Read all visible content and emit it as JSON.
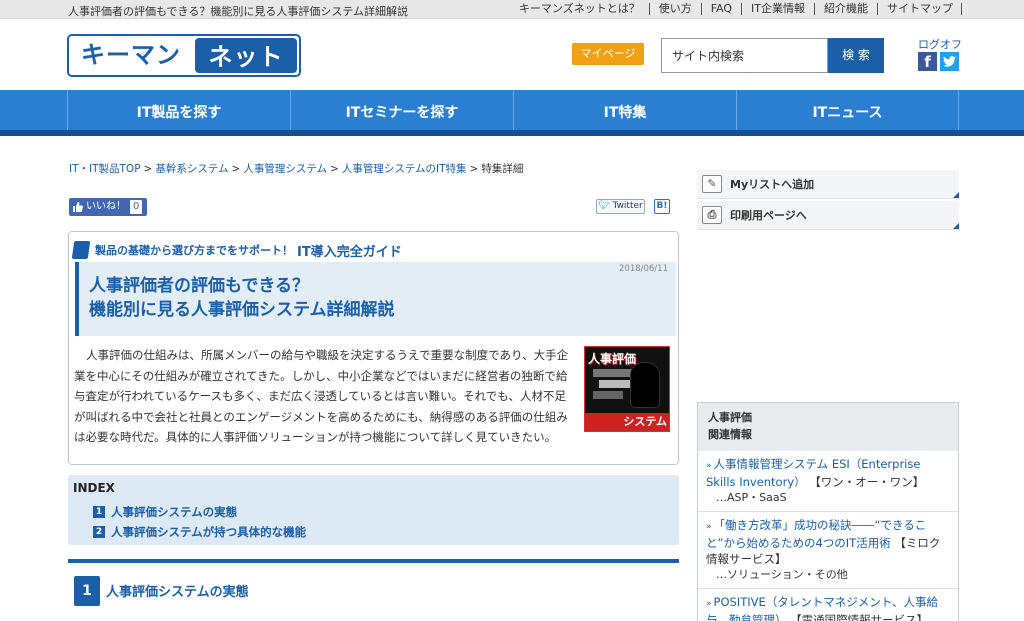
{
  "topbar": {
    "tagline": "人事評価者の評価もできる？機能別に見る人事評価システム詳細解説",
    "links": [
      "キーマンズネットとは？",
      "使い方",
      "FAQ",
      "IT企業情報",
      "紹介機能",
      "サイトマップ"
    ]
  },
  "header": {
    "logo_left": "キーマンズ",
    "logo_right": "ネット",
    "mypage_label": "マイページ",
    "search_placeholder": "サイト内検索",
    "search_button": "検 索",
    "logoff_label": "ログオフ"
  },
  "mainnav": [
    "IT製品を探す",
    "ITセミナーを探す",
    "IT特集",
    "ITニュース"
  ],
  "breadcrumb": {
    "items": [
      "IT・IT製品TOP",
      "基幹系システム",
      "人事管理システム",
      "人事管理システムのIT特集"
    ],
    "current": "特集詳細"
  },
  "social": {
    "like_label": "いいね！",
    "like_count": "0",
    "twitter_label": "Twitter",
    "hatena_label": "B!"
  },
  "article": {
    "guide_sub": "製品の基礎から選び方までをサポート！",
    "guide_main": "IT導入完全ガイド",
    "date": "2018/06/11",
    "title_line1": "人事評価者の評価もできる？",
    "title_line2": "機能別に見る人事評価システム詳細解説",
    "intro": "人事評価の仕組みは、所属メンバーの給与や職級を決定するうえで重要な制度であり、大手企業を中心にその仕組みが確立されてきた。しかし、中小企業などではいまだに経営者の独断で給与査定が行われているケースも多く、まだ広く浸透しているとは言い難い。それでも、人材不足が叫ばれる中で会社と社員とのエンゲージメントを高めるためにも、納得感のある評価の仕組みは必要な時代だ。具体的に人事評価ソリューションが持つ機能について詳しく見ていきたい。",
    "thumb_title": "人事評価",
    "thumb_bottom": "システム"
  },
  "index": {
    "title": "INDEX",
    "items": [
      {
        "num": "1",
        "label": "人事評価システムの実態"
      },
      {
        "num": "2",
        "label": "人事評価システムが持つ具体的な機能"
      }
    ]
  },
  "section": {
    "num": "1",
    "title": "人事評価システムの実態"
  },
  "sidebar": {
    "tools": [
      "Myリストへ追加",
      "印刷用ページへ"
    ],
    "related_title_line1": "人事評価",
    "related_title_line2": "関連情報",
    "related": [
      {
        "link": "人事情報管理システム ESI（Enterprise Skills Inventory）",
        "vendor": "【ワン・オー・ワン】",
        "category": "…ASP・SaaS"
      },
      {
        "link": "「働き方改革」成功の秘訣――“できること”から始めるための4つのIT活用術",
        "vendor": "【ミロク情報サービス】",
        "category": "…ソリューション・その他"
      },
      {
        "link": "POSITIVE（タレントマネジメント、人事給与、勤怠管理）",
        "vendor": "【電通国際情報サービス】",
        "category": ""
      }
    ]
  },
  "colors": {
    "brand_blue": "#1a5fa8",
    "nav_blue": "#2b7fd0",
    "mypage_orange": "#f2a016"
  }
}
